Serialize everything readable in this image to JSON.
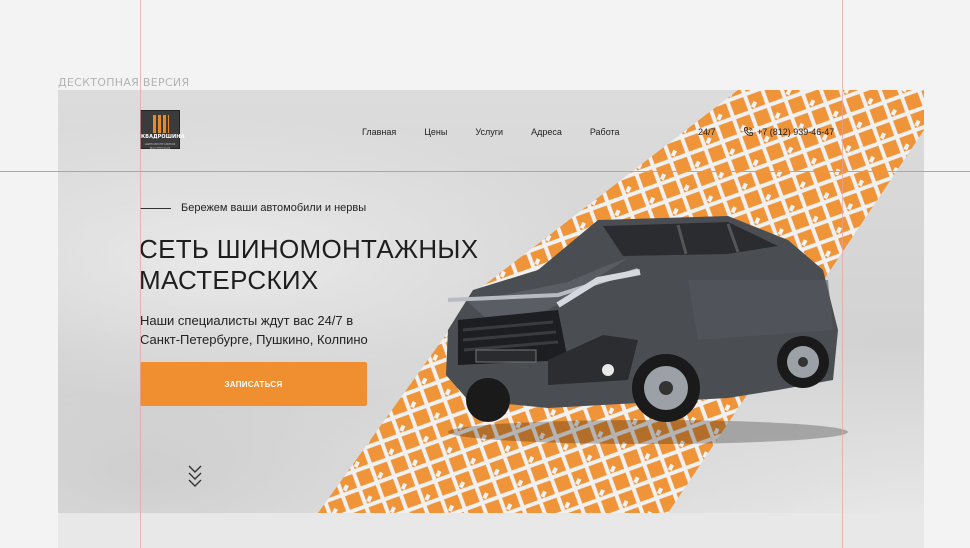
{
  "page_label": "ДЕСКТОПНАЯ ВЕРСИЯ",
  "logo": {
    "name": "КВАДРОШИНА",
    "tagline": "ШИНОМОНТАЖНАЯ МАСТЕРСКАЯ"
  },
  "nav": {
    "items": [
      {
        "label": "Главная"
      },
      {
        "label": "Цены"
      },
      {
        "label": "Услуги"
      },
      {
        "label": "Адреса"
      },
      {
        "label": "Работа"
      }
    ]
  },
  "contact": {
    "hours": "24/7",
    "phone": "+7 (812) 939-46-47",
    "phone_icon": "phone-icon"
  },
  "hero": {
    "tagline": "Бережем ваши автомобили и нервы",
    "title_line1": "СЕТЬ ШИНОМОНТАЖНЫХ",
    "title_line2": "МАСТЕРСКИХ",
    "subtitle_line1": "Наши специалисты ждут вас 24/7 в",
    "subtitle_line2": "Санкт-Петербурге, Пушкино, Колпино",
    "cta_label": "ЗАПИСАТЬСЯ",
    "scroll_icon": "chevrons-down-icon"
  },
  "colors": {
    "accent": "#EF8F2F",
    "text": "#1E1E1E"
  }
}
